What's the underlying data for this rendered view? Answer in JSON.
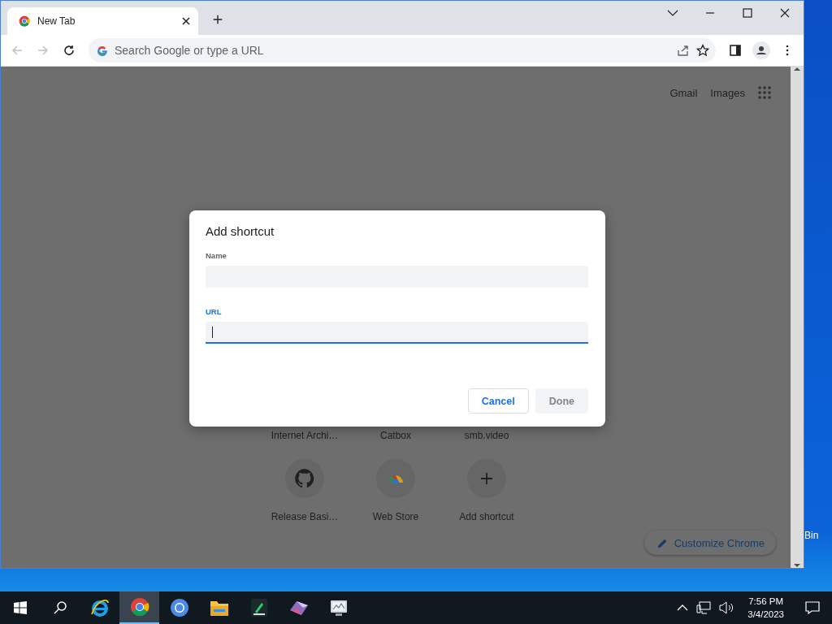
{
  "browser": {
    "tabs": [
      {
        "title": "New Tab",
        "selected": true
      }
    ],
    "toolbar": {
      "back_disabled": true,
      "forward_disabled": true,
      "omnibox": {
        "placeholder": "Search Google or type a URL"
      }
    },
    "new_tab_page": {
      "header_links": [
        "Gmail",
        "Images"
      ],
      "shortcuts": [
        {
          "kind": "covered",
          "label": "Internet Archi…"
        },
        {
          "kind": "covered",
          "label": "Catbox"
        },
        {
          "kind": "covered",
          "label": "smb.video"
        },
        {
          "kind": "github",
          "label": "Release Basi…"
        },
        {
          "kind": "webstore",
          "label": "Web Store"
        },
        {
          "kind": "add",
          "label": "Add shortcut"
        }
      ],
      "customize_button": "Customize Chrome"
    }
  },
  "dialog": {
    "title": "Add shortcut",
    "fields": [
      {
        "label": "Name",
        "focused": false
      },
      {
        "label": "URL",
        "focused": true
      }
    ],
    "buttons": [
      {
        "label": "Cancel",
        "disabled": false
      },
      {
        "label": "Done",
        "disabled": true
      }
    ]
  },
  "desktop": {
    "icon_label": "Bin"
  },
  "taskbar": {
    "apps": [
      {
        "kind": "ie",
        "selected": false
      },
      {
        "kind": "chrome",
        "selected": true
      },
      {
        "kind": "chromium",
        "selected": false
      },
      {
        "kind": "explorer",
        "selected": false
      },
      {
        "kind": "editor",
        "selected": false
      },
      {
        "kind": "paint",
        "selected": false
      },
      {
        "kind": "monitor",
        "selected": false
      }
    ],
    "time": "7:56 PM",
    "date": "3/4/2023"
  }
}
